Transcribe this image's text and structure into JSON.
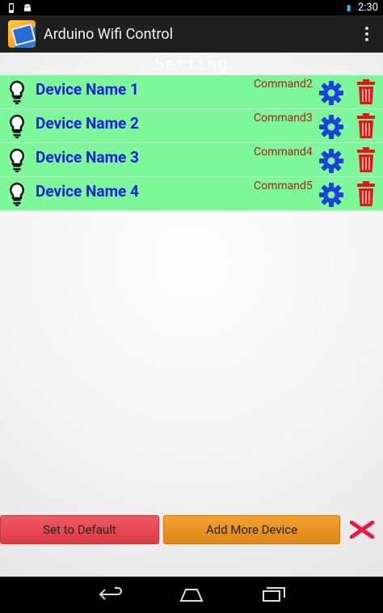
{
  "status_bar": {
    "time": "2:30"
  },
  "action_bar": {
    "title": "Arduino Wifi Control"
  },
  "setting": {
    "title": "Setting"
  },
  "devices": [
    {
      "name": "Device Name 1",
      "command": "Command2"
    },
    {
      "name": "Device Name 2",
      "command": "Command3"
    },
    {
      "name": "Device Name 3",
      "command": "Command4"
    },
    {
      "name": "Device Name 4",
      "command": "Command5"
    }
  ],
  "buttons": {
    "set_default": "Set to Default",
    "add_more": "Add More Device"
  },
  "colors": {
    "row_bg": "#7df79a",
    "device_name": "#1a1fe0",
    "command": "#b21f12",
    "gear": "#1a43d9",
    "trash": "#e51616",
    "set_default_bg": "#e8454f",
    "add_more_bg": "#ee9a27",
    "close_x": "#e51a45"
  },
  "icons": {
    "device_icon": "lightbulb-icon",
    "settings_icon": "gear-icon",
    "delete_icon": "trash-icon",
    "close_icon": "close-icon"
  }
}
